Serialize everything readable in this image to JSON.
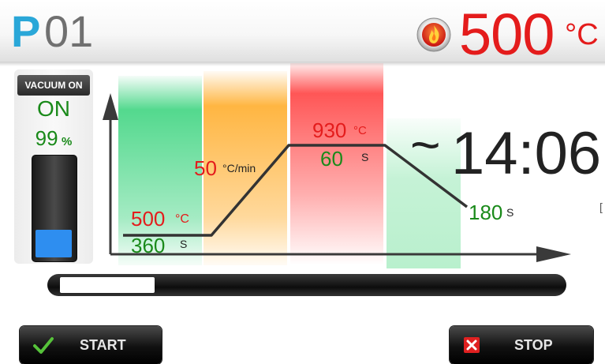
{
  "header": {
    "program_letter": "P",
    "program_number": "01",
    "furnace_temp": "500",
    "furnace_unit": "°C",
    "icon": "flame-icon"
  },
  "vacuum": {
    "label": "VACUUM ON",
    "state": "ON",
    "percent": "99",
    "percent_unit": "%",
    "level_fraction": 0.28
  },
  "profile": {
    "start_temp": "500",
    "start_temp_unit": "°C",
    "start_hold": "360",
    "start_hold_unit": "S",
    "heat_rate": "50",
    "heat_rate_unit": "°C/min",
    "peak_temp": "930",
    "peak_temp_unit": "°C",
    "peak_hold": "60",
    "peak_hold_unit": "S",
    "cooling": "180",
    "cooling_unit": "S",
    "time_tilde": "~",
    "remaining_time": "14:06"
  },
  "progress": {
    "fraction": 0.19
  },
  "buttons": {
    "start": "START",
    "stop": "STOP"
  },
  "colors": {
    "accent_red": "#e41c1c",
    "accent_green": "#1a8a1a",
    "program_blue": "#2aa7d8",
    "band_green": "#35d27a",
    "band_orange": "#ffb238",
    "band_red": "#ff4d4d",
    "band_light_green": "#7fe3a4"
  }
}
